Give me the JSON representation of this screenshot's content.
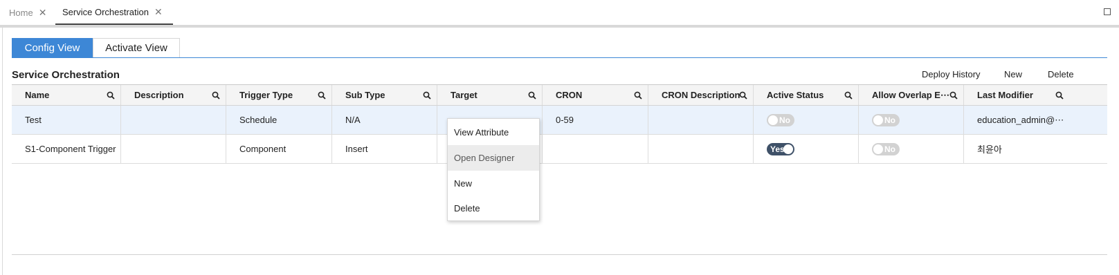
{
  "tabs": [
    {
      "label": "Home"
    },
    {
      "label": "Service Orchestration"
    }
  ],
  "view_tabs": {
    "config": "Config View",
    "activate": "Activate View"
  },
  "section_title": "Service Orchestration",
  "actions": {
    "deploy_history": "Deploy History",
    "new": "New",
    "delete": "Delete"
  },
  "columns": [
    "Name",
    "Description",
    "Trigger Type",
    "Sub Type",
    "Target",
    "CRON",
    "CRON Description",
    "Active Status",
    "Allow Overlap E⋯",
    "Last Modifier"
  ],
  "rows": [
    {
      "name": "Test",
      "description": "",
      "trigger_type": "Schedule",
      "sub_type": "N/A",
      "target": "",
      "cron": "0-59",
      "cron_description": "",
      "active_status": "No",
      "allow_overlap": "No",
      "last_modifier": "education_admin@⋯"
    },
    {
      "name": "S1-Component Trigger",
      "description": "",
      "trigger_type": "Component",
      "sub_type": "Insert",
      "target": "",
      "cron": "",
      "cron_description": "",
      "active_status": "Yes",
      "allow_overlap": "No",
      "last_modifier": "최윤아"
    }
  ],
  "context_menu": [
    "View Attribute",
    "Open Designer",
    "New",
    "Delete"
  ],
  "colors": {
    "accent": "#3d87d6",
    "selected_row": "#eaf2fc",
    "toggle_on": "#3f5168",
    "toggle_off": "#d2d2d2"
  },
  "icons": {
    "tab_close": "close-icon",
    "maximize": "maximize-icon",
    "column_search": "search-icon"
  }
}
